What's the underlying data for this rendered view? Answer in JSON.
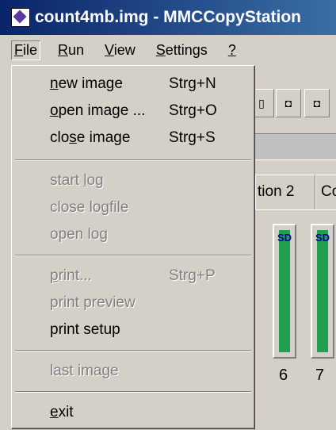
{
  "window": {
    "title": "count4mb.img - MMCCopyStation"
  },
  "menubar": {
    "file": {
      "pre": "",
      "acc": "F",
      "post": "ile"
    },
    "run": {
      "pre": "",
      "acc": "R",
      "post": "un"
    },
    "view": {
      "pre": "",
      "acc": "V",
      "post": "iew"
    },
    "settings": {
      "pre": "",
      "acc": "S",
      "post": "ettings"
    },
    "help": {
      "pre": "",
      "acc": "?",
      "post": ""
    }
  },
  "file_menu": {
    "new_image": {
      "pre": "",
      "acc": "n",
      "post": "ew image",
      "shortcut": "Strg+N"
    },
    "open_image": {
      "pre": "",
      "acc": "o",
      "post": "pen image ...",
      "shortcut": "Strg+O"
    },
    "close_image": {
      "pre": "clo",
      "acc": "s",
      "post": "e image",
      "shortcut": "Strg+S"
    },
    "start_log": {
      "pre": "start ",
      "acc": "l",
      "post": "og"
    },
    "close_logfile": {
      "pre": "close lo",
      "acc": "g",
      "post": "file"
    },
    "open_log": {
      "pre": "open log",
      "acc": "",
      "post": ""
    },
    "print": {
      "pre": "",
      "acc": "p",
      "post": "rint...",
      "shortcut": "Strg+P"
    },
    "print_preview": {
      "pre": "print preview",
      "acc": "",
      "post": ""
    },
    "print_setup": {
      "pre": "print setup",
      "acc": "",
      "post": ""
    },
    "last_image": {
      "pre": "last image",
      "acc": "",
      "post": ""
    },
    "exit": {
      "pre": "",
      "acc": "e",
      "post": "xit"
    }
  },
  "background": {
    "tabs": [
      "tion 2",
      "Co"
    ],
    "slots": [
      {
        "label": "SD",
        "number": "6"
      },
      {
        "label": "SD",
        "number": "7"
      }
    ],
    "toolbar_icons": [
      "copy-in-icon",
      "copy-out-icon",
      "copy-icon"
    ]
  },
  "colors": {
    "title_bar": "#0a246a",
    "slot_green": "#20a050",
    "menu_bg": "#d4d0c8"
  }
}
